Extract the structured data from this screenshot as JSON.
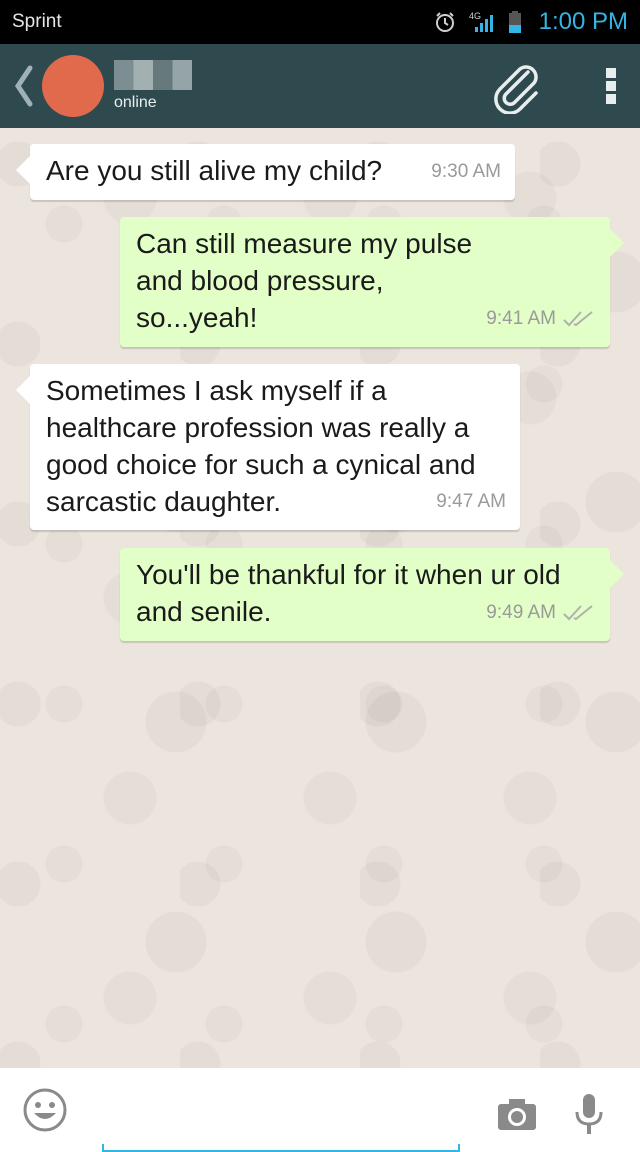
{
  "status_bar": {
    "carrier": "Sprint",
    "network": "4G",
    "time": "1:00 PM",
    "icons": [
      "alarm-icon",
      "signal-icon",
      "battery-icon"
    ]
  },
  "header": {
    "contact_name": "",
    "contact_status": "online",
    "icons": [
      "back-arrow-icon",
      "paperclip-icon",
      "overflow-menu-icon"
    ],
    "colors": {
      "bar": "#2f4a4f",
      "avatar": "#e06a4b"
    }
  },
  "messages": [
    {
      "direction": "incoming",
      "text": "Are you still alive my child?",
      "time": "9:30 AM"
    },
    {
      "direction": "outgoing",
      "text": "Can still measure my pulse and blood pressure, so...yeah!",
      "time": "9:41 AM",
      "status": "delivered"
    },
    {
      "direction": "incoming",
      "text": "Sometimes I ask myself if a healthcare profession was really a good choice for such a cynical and sarcastic daughter.",
      "time": "9:47 AM"
    },
    {
      "direction": "outgoing",
      "text": "You'll be thankful for it when ur old and senile.",
      "time": "9:49 AM",
      "status": "delivered"
    }
  ],
  "input_bar": {
    "placeholder": "",
    "value": "",
    "icons": [
      "emoji-icon",
      "camera-icon",
      "microphone-icon"
    ],
    "accent": "#33b5e5"
  },
  "colors": {
    "incoming_bubble": "#ffffff",
    "outgoing_bubble": "#e2ffc7",
    "chat_background": "#ece5dd"
  }
}
